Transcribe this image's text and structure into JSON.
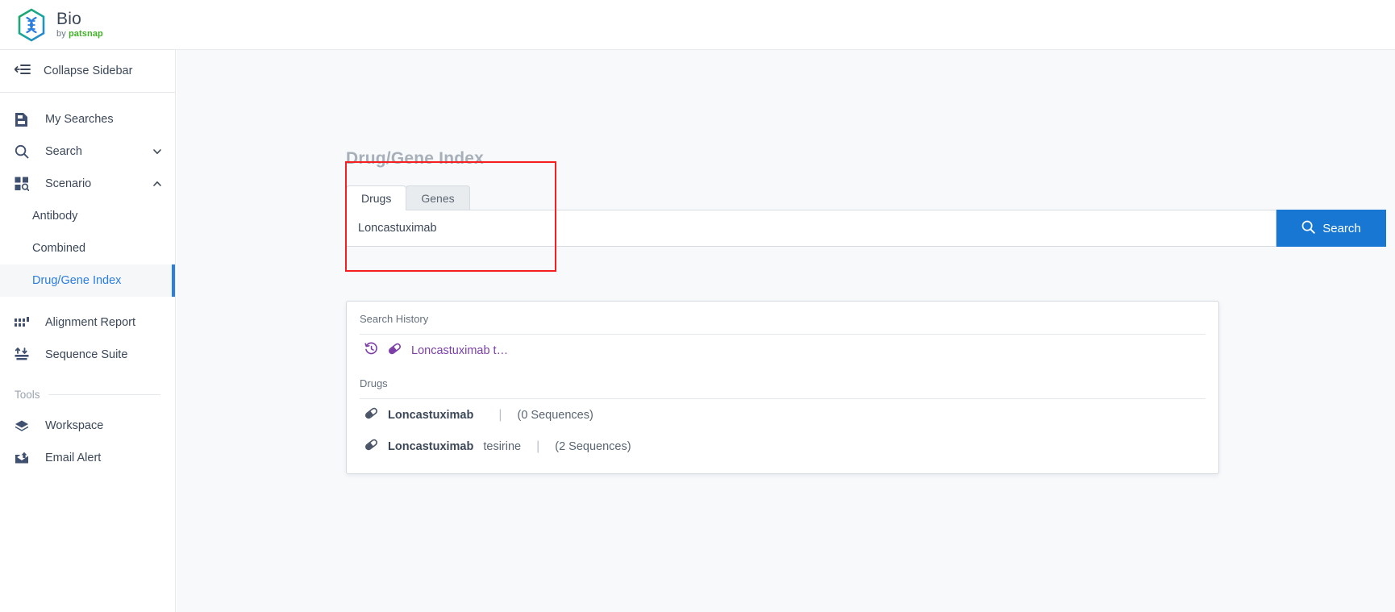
{
  "brand": {
    "title": "Bio",
    "subtitle_prefix": "by ",
    "subtitle_brand": "patsnap",
    "logo_icon": "dna-hexagon-icon",
    "hex_outer_color": "#1a9e5f",
    "hex_inner_color": "#2b7de0"
  },
  "sidebar": {
    "collapse": {
      "label": "Collapse Sidebar",
      "icon": "collapse-sidebar-icon"
    },
    "items": [
      {
        "label": "My Searches",
        "icon": "saved-document-icon",
        "type": "link"
      },
      {
        "label": "Search",
        "icon": "magnifier-icon",
        "type": "group",
        "chevron": "chevron-down-icon",
        "expanded": false
      },
      {
        "label": "Scenario",
        "icon": "grid-search-icon",
        "type": "group",
        "chevron": "chevron-up-icon",
        "expanded": true
      }
    ],
    "scenario_children": [
      {
        "label": "Antibody",
        "active": false
      },
      {
        "label": "Combined",
        "active": false
      },
      {
        "label": "Drug/Gene Index",
        "active": true
      }
    ],
    "items_after": [
      {
        "label": "Alignment Report",
        "icon": "bar-grid-icon"
      },
      {
        "label": "Sequence Suite",
        "icon": "sequence-suite-icon"
      }
    ],
    "tools_section": {
      "label": "Tools"
    },
    "tools_items": [
      {
        "label": "Workspace",
        "icon": "cube-icon"
      },
      {
        "label": "Email Alert",
        "icon": "email-alert-icon"
      }
    ],
    "active_accent_color": "#2b7de0"
  },
  "panel": {
    "title": "Drug/Gene Index",
    "tabs": [
      {
        "label": "Drugs",
        "active": true
      },
      {
        "label": "Genes",
        "active": false
      }
    ],
    "search": {
      "value": "Loncastuximab",
      "placeholder": "",
      "button_label": "Search",
      "button_icon": "search-icon",
      "button_color": "#1777d2"
    }
  },
  "dropdown": {
    "history_label": "Search History",
    "history_items": [
      {
        "clock_icon": "history-clock-icon",
        "pill_icon": "pill-icon",
        "text": "Loncastuximab t…",
        "color": "#7c3fa8"
      }
    ],
    "drugs_label": "Drugs",
    "drug_items": [
      {
        "pill_icon": "pill-icon",
        "name": "Loncastuximab",
        "tail": "",
        "separator": "|",
        "sequences": "(0 Sequences)"
      },
      {
        "pill_icon": "pill-icon",
        "name": "Loncastuximab",
        "tail": " tesirine",
        "separator": "|",
        "sequences": "(2 Sequences)"
      }
    ]
  },
  "annotation": {
    "shape": "rectangle",
    "color": "#f51f1f"
  }
}
